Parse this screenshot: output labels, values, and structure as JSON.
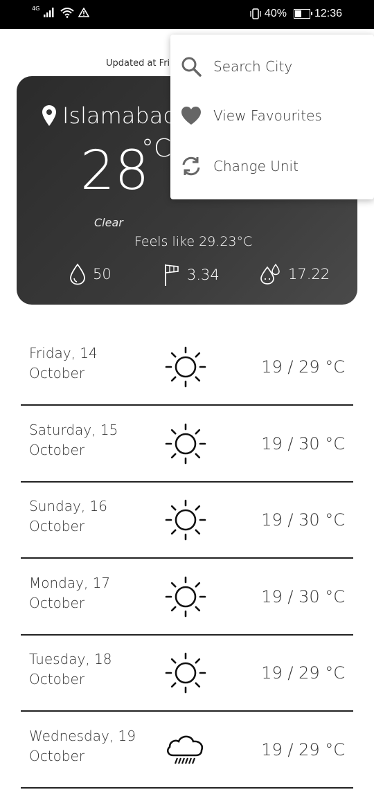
{
  "status_bar": {
    "network": "4G",
    "battery_pct": "40%",
    "time": "12:36"
  },
  "updated_text": "Updated at Fri",
  "current": {
    "city": "Islamabad",
    "temperature": "28",
    "unit": "°C",
    "condition": "Clear",
    "feels_like": "Feels like 29.23°C",
    "humidity": "50",
    "wind": "3.34",
    "dew": "17.22"
  },
  "menu": {
    "items": [
      {
        "label": "Search City",
        "icon": "search-icon"
      },
      {
        "label": "View Favourites",
        "icon": "heart-icon"
      },
      {
        "label": "Change Unit",
        "icon": "refresh-icon"
      }
    ]
  },
  "forecast": [
    {
      "day": "Friday, 14",
      "month": "October",
      "temp": "19 / 29 °C",
      "icon": "sun-icon"
    },
    {
      "day": "Saturday, 15",
      "month": "October",
      "temp": "19 / 30 °C",
      "icon": "sun-icon"
    },
    {
      "day": "Sunday, 16",
      "month": "October",
      "temp": "19 / 30 °C",
      "icon": "sun-icon"
    },
    {
      "day": "Monday, 17",
      "month": "October",
      "temp": "19 / 30 °C",
      "icon": "sun-icon"
    },
    {
      "day": "Tuesday, 18",
      "month": "October",
      "temp": "19 / 29 °C",
      "icon": "sun-icon"
    },
    {
      "day": "Wednesday, 19",
      "month": "October",
      "temp": "19 / 29 °C",
      "icon": "rain-cloud-icon"
    }
  ]
}
